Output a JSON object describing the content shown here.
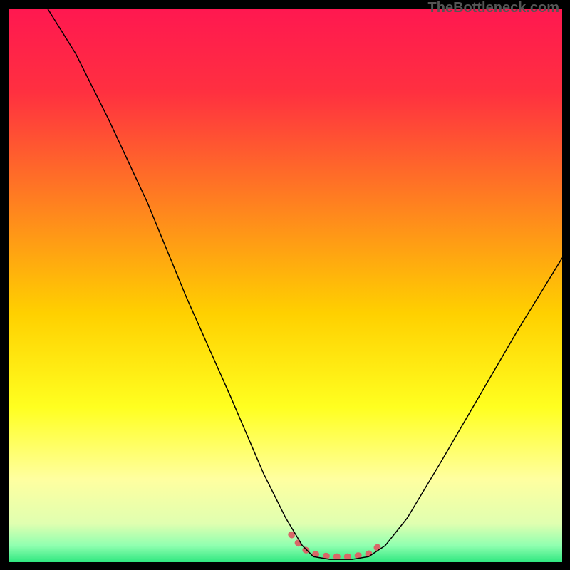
{
  "watermark": "TheBottleneck.com",
  "chart_data": {
    "type": "line",
    "title": "",
    "xlabel": "",
    "ylabel": "",
    "xlim": [
      0,
      100
    ],
    "ylim": [
      0,
      100
    ],
    "background": {
      "type": "vertical-gradient",
      "stops": [
        {
          "offset": 0,
          "color": "#ff1850"
        },
        {
          "offset": 0.15,
          "color": "#ff3040"
        },
        {
          "offset": 0.35,
          "color": "#ff8020"
        },
        {
          "offset": 0.55,
          "color": "#ffd000"
        },
        {
          "offset": 0.72,
          "color": "#ffff20"
        },
        {
          "offset": 0.85,
          "color": "#ffffa0"
        },
        {
          "offset": 0.93,
          "color": "#e0ffb0"
        },
        {
          "offset": 0.97,
          "color": "#90ffb0"
        },
        {
          "offset": 1.0,
          "color": "#30e880"
        }
      ]
    },
    "series": [
      {
        "name": "bottleneck-curve",
        "color": "#000000",
        "stroke_width": 1.5,
        "points": [
          {
            "x": 7,
            "y": 100
          },
          {
            "x": 12,
            "y": 92
          },
          {
            "x": 18,
            "y": 80
          },
          {
            "x": 25,
            "y": 65
          },
          {
            "x": 32,
            "y": 48
          },
          {
            "x": 40,
            "y": 30
          },
          {
            "x": 46,
            "y": 16
          },
          {
            "x": 50,
            "y": 8
          },
          {
            "x": 53,
            "y": 3
          },
          {
            "x": 55,
            "y": 1
          },
          {
            "x": 58,
            "y": 0.5
          },
          {
            "x": 62,
            "y": 0.5
          },
          {
            "x": 65,
            "y": 1
          },
          {
            "x": 68,
            "y": 3
          },
          {
            "x": 72,
            "y": 8
          },
          {
            "x": 78,
            "y": 18
          },
          {
            "x": 85,
            "y": 30
          },
          {
            "x": 92,
            "y": 42
          },
          {
            "x": 100,
            "y": 55
          }
        ]
      },
      {
        "name": "valley-highlight",
        "color": "#d86868",
        "stroke_width": 9,
        "points": [
          {
            "x": 51,
            "y": 5
          },
          {
            "x": 53,
            "y": 2.5
          },
          {
            "x": 55,
            "y": 1.5
          },
          {
            "x": 58,
            "y": 1
          },
          {
            "x": 62,
            "y": 1
          },
          {
            "x": 65,
            "y": 1.5
          },
          {
            "x": 67,
            "y": 3
          }
        ]
      }
    ]
  }
}
